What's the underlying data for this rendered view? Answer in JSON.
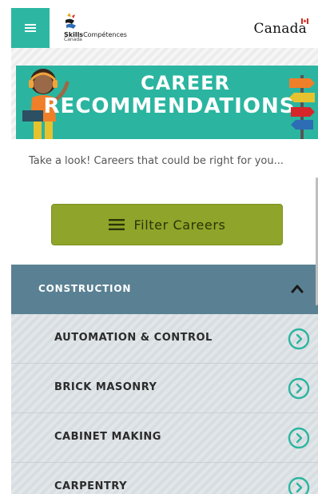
{
  "header": {
    "logo_brand": "Skills",
    "logo_text": "Compétences",
    "logo_sub": "Canada",
    "wordmark": "Canada"
  },
  "banner": {
    "line1": "CAREER",
    "line2": "RECOMMENDATIONS"
  },
  "intro": {
    "text": "Take a look! Careers that could be right for you..."
  },
  "filter": {
    "label": "Filter Careers"
  },
  "category": {
    "label": "CONSTRUCTION"
  },
  "careers": [
    {
      "label": "AUTOMATION & CONTROL"
    },
    {
      "label": "BRICK MASONRY"
    },
    {
      "label": "CABINET MAKING"
    },
    {
      "label": "CARPENTRY"
    }
  ],
  "colors": {
    "teal": "#2bb5a0",
    "filter_green": "#8ea42a",
    "category_blue": "#5a8193"
  }
}
